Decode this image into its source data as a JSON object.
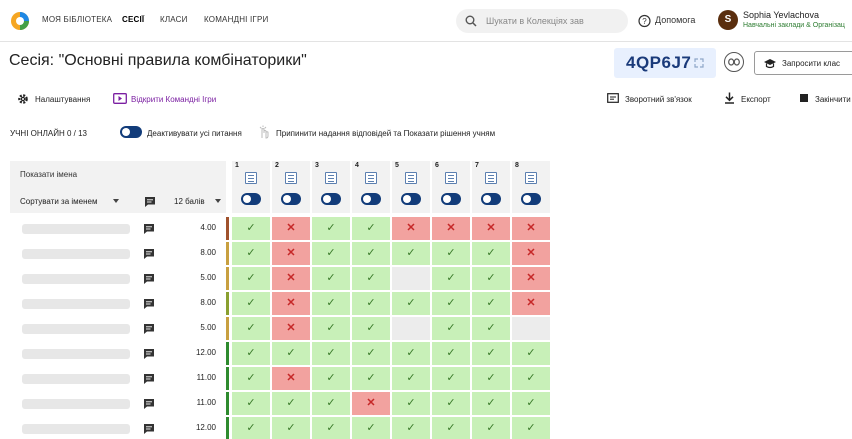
{
  "nav": {
    "links": [
      "МОЯ БІБЛІОТЕКА",
      "СЕСІЇ",
      "КЛАСИ",
      "КОМАНДНІ ІГРИ"
    ],
    "active_index": 1,
    "search_placeholder": "Шукати в Колекціях зав",
    "help_label": "Допомога",
    "user_initial": "S",
    "user_name": "Sophia Yevlachova",
    "user_org": "Навчальні заклади & Організац"
  },
  "session": {
    "title": "Сесія: \"Основні правила комбінаторики\"",
    "code": "4QP6J7",
    "invite_label": "Запросити клас"
  },
  "actions": {
    "settings": "Налаштування",
    "open_team_games": "Відкрити Командні Ігри",
    "feedback": "Зворотний зв'язок",
    "export": "Експорт",
    "finish": "Закінчити"
  },
  "controls": {
    "online": "УЧНІ ОНЛАЙН 0 / 13",
    "deactivate_all": "Деактивувати усі питання",
    "stop_answers": "Припинити надання відповідей та Показати рішення учням"
  },
  "grid": {
    "show_names": "Показати імена",
    "sort_by": "Сортувати за іменем",
    "score_header": "12 балів",
    "questions": [
      "1",
      "2",
      "3",
      "4",
      "5",
      "6",
      "7",
      "8"
    ],
    "rows": [
      {
        "score": "4.00",
        "bar": "#a0522d",
        "cells": [
          "c",
          "w",
          "c",
          "c",
          "w",
          "w",
          "w",
          "w"
        ]
      },
      {
        "score": "8.00",
        "bar": "#c8a040",
        "cells": [
          "c",
          "w",
          "c",
          "c",
          "c",
          "c",
          "c",
          "w"
        ]
      },
      {
        "score": "5.00",
        "bar": "#c8a040",
        "cells": [
          "c",
          "w",
          "c",
          "c",
          "e",
          "c",
          "c",
          "w"
        ]
      },
      {
        "score": "8.00",
        "bar": "#8aa030",
        "cells": [
          "c",
          "w",
          "c",
          "c",
          "c",
          "c",
          "c",
          "w"
        ]
      },
      {
        "score": "5.00",
        "bar": "#c8a040",
        "cells": [
          "c",
          "w",
          "c",
          "c",
          "e",
          "c",
          "c",
          "e"
        ]
      },
      {
        "score": "12.00",
        "bar": "#2e8b2e",
        "cells": [
          "c",
          "c",
          "c",
          "c",
          "c",
          "c",
          "c",
          "c"
        ]
      },
      {
        "score": "11.00",
        "bar": "#2e8b2e",
        "cells": [
          "c",
          "w",
          "c",
          "c",
          "c",
          "c",
          "c",
          "c"
        ]
      },
      {
        "score": "11.00",
        "bar": "#2e8b2e",
        "cells": [
          "c",
          "c",
          "c",
          "w",
          "c",
          "c",
          "c",
          "c"
        ]
      },
      {
        "score": "12.00",
        "bar": "#2e8b2e",
        "cells": [
          "c",
          "c",
          "c",
          "c",
          "c",
          "c",
          "c",
          "c"
        ]
      }
    ]
  },
  "colors": {
    "correct": "#c8f0b8",
    "wrong": "#f2a29f",
    "empty": "#ececec",
    "toggle": "#123c7a",
    "accent_purple": "#7b1fa2"
  },
  "icons": {
    "correct": "check-icon",
    "wrong": "cross-icon",
    "chat": "chat-icon"
  }
}
